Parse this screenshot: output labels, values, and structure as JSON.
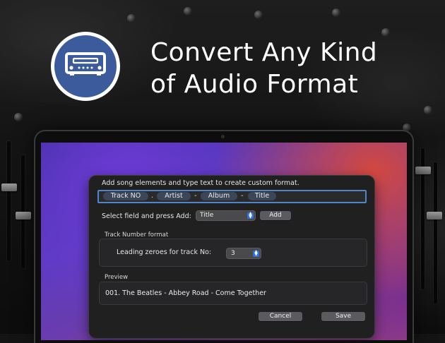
{
  "headline": {
    "line1": "Convert Any Kind",
    "line2": "of Audio Format"
  },
  "badge": {
    "icon": "audio-receiver-icon",
    "accent": "#3c5b9d"
  },
  "dialog": {
    "instruction": "Add song elements and type text to create custom format.",
    "format_tokens": [
      "Track NO",
      "Artist",
      "Album",
      "Title"
    ],
    "format_separators": [
      ".",
      "-",
      "-"
    ],
    "select_label": "Select field and press Add:",
    "select_value": "Title",
    "add_label": "Add",
    "track_group": {
      "title": "Track Number format",
      "zeroes_label": "Leading zeroes for track No:",
      "zeroes_value": "3"
    },
    "preview_group": {
      "title": "Preview",
      "text": "001. The Beatles - Abbey Road - Come Together"
    },
    "cancel_label": "Cancel",
    "save_label": "Save"
  },
  "colors": {
    "focus_ring": "#4d86c9",
    "token_bg": "#3b4658",
    "stepper_accent": "#2f6fdf"
  }
}
